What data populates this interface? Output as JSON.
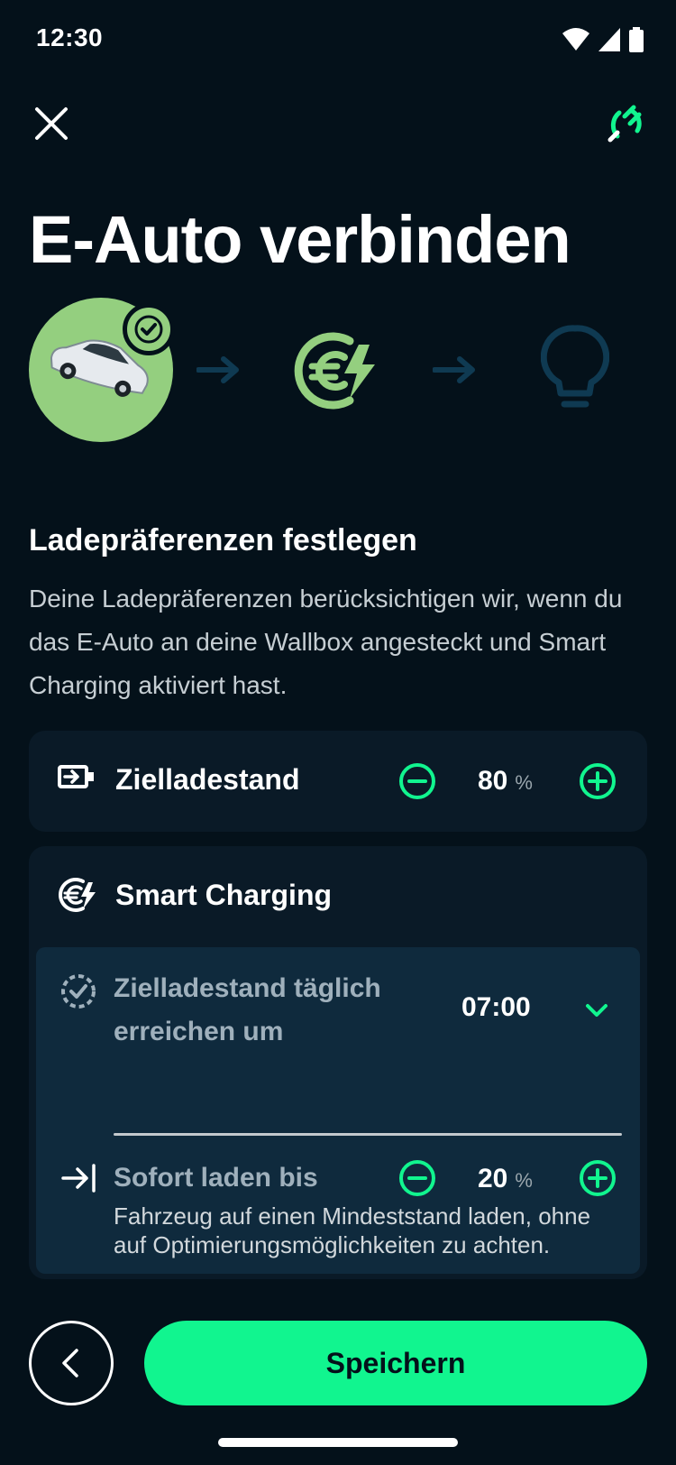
{
  "status_bar": {
    "time": "12:30"
  },
  "title": "E-Auto verbinden",
  "steps": {
    "step1_icon": "car-icon",
    "step1_state": "completed",
    "step2_icon": "euro-bolt-icon",
    "step3_icon": "lightbulb-icon",
    "colors": {
      "done": "#94cf7f",
      "current": "#94cf7f",
      "pending": "#0f3a52"
    }
  },
  "section": {
    "title": "Ladepräferenzen festlegen",
    "description": "Deine Ladepräferenzen berücksichtigen wir, wenn du das E-Auto an deine Wallbox angesteckt und Smart Charging aktiviert hast."
  },
  "target_charge": {
    "label": "Zielladestand",
    "value": "80",
    "unit": "%"
  },
  "smart_charging": {
    "label": "Smart Charging",
    "daily": {
      "label_line1": "Zielladestand täglich",
      "label_line2": "erreichen um",
      "time": "07:00"
    },
    "instant": {
      "label": "Sofort laden bis",
      "value": "20",
      "unit": "%",
      "description": "Fahrzeug auf einen Mindeststand laden, ohne auf Optimierungsmöglichkeiten zu achten."
    }
  },
  "footer": {
    "save_label": "Speichern"
  },
  "colors": {
    "accent": "#11f58f",
    "background": "#04111a",
    "card": "#0a1a27",
    "panel": "#0f2a3d"
  }
}
